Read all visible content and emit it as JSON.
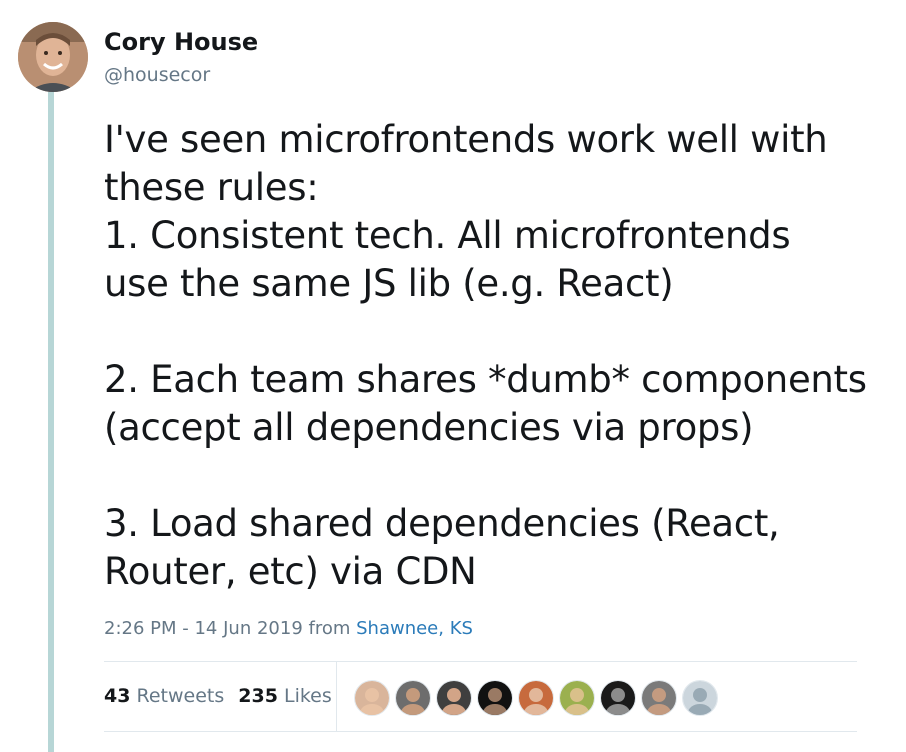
{
  "author": {
    "name": "Cory House",
    "handle": "@housecor"
  },
  "tweet": {
    "lines": [
      "I've seen microfrontends work well with",
      "these rules:",
      "1. Consistent tech. All microfrontends",
      "use the same JS lib (e.g. React)",
      "",
      "2. Each team shares *dumb* components",
      "(accept all dependencies via props)",
      "",
      "3. Load shared dependencies (React,",
      "Router, etc) via CDN"
    ]
  },
  "meta": {
    "time": "2:26 PM",
    "separator": " - ",
    "date": "14 Jun 2019",
    "from_label": " from ",
    "location": "Shawnee, KS"
  },
  "stats": {
    "retweets_count": "43",
    "retweets_label": "Retweets",
    "likes_count": "235",
    "likes_label": "Likes"
  },
  "likers": [
    {
      "name": "liker-avatar-1",
      "bg": "#d9b59b",
      "skin": "#e8c2a4"
    },
    {
      "name": "liker-avatar-2",
      "bg": "#6d6d6d",
      "skin": "#c49a7c"
    },
    {
      "name": "liker-avatar-3",
      "bg": "#3f3f3f",
      "skin": "#d2a487"
    },
    {
      "name": "liker-avatar-4",
      "bg": "#111111",
      "skin": "#9a7a64"
    },
    {
      "name": "liker-avatar-5",
      "bg": "#c76a3d",
      "skin": "#e2b79a"
    },
    {
      "name": "liker-avatar-6",
      "bg": "#9bb04f",
      "skin": "#d9c08a"
    },
    {
      "name": "liker-avatar-7",
      "bg": "#1a1a1a",
      "skin": "#8c8c8c"
    },
    {
      "name": "liker-avatar-8",
      "bg": "#7a7a7a",
      "skin": "#c49b80"
    },
    {
      "name": "liker-avatar-9",
      "bg": "#ccd6dd",
      "skin": "#99aab5"
    }
  ]
}
